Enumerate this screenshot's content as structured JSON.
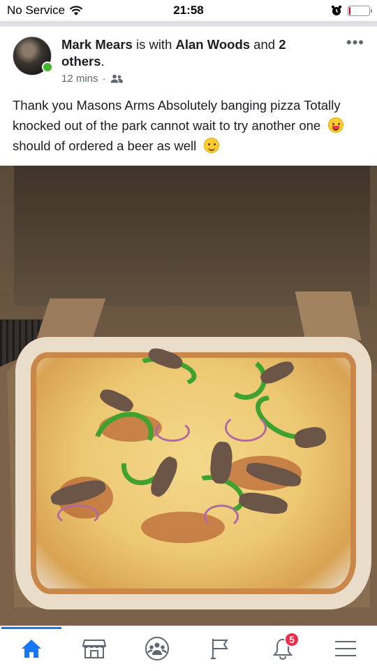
{
  "status_bar": {
    "carrier": "No Service",
    "time": "21:58",
    "battery_level": 0.05,
    "battery_color": "#d0021b"
  },
  "post": {
    "author": "Mark Mears",
    "with_text": " is with ",
    "tagged": "Alan Woods",
    "and_text": " and ",
    "others": "2 others",
    "period": ".",
    "time": "12 mins",
    "separator": "·",
    "audience_icon": "friends-icon",
    "online_color": "#42b72a",
    "text_part1": "Thank you Masons Arms Absolutely banging pizza Totally knocked out of the park cannot wait to try another one ",
    "emoji1": "face-savoring-food-emoji",
    "text_part2": " should of ordered a beer as well ",
    "emoji2": "smiling-face-emoji"
  },
  "photo": {
    "subject": "pizza-in-box-photo"
  },
  "nav": {
    "items": [
      {
        "name": "home-icon",
        "active": true
      },
      {
        "name": "marketplace-icon",
        "active": false
      },
      {
        "name": "groups-icon",
        "active": false
      },
      {
        "name": "pages-flag-icon",
        "active": false
      },
      {
        "name": "notifications-bell-icon",
        "active": false,
        "badge": "5"
      },
      {
        "name": "menu-icon",
        "active": false
      }
    ],
    "accent_color": "#1877f2",
    "badge_color": "#f02849"
  }
}
